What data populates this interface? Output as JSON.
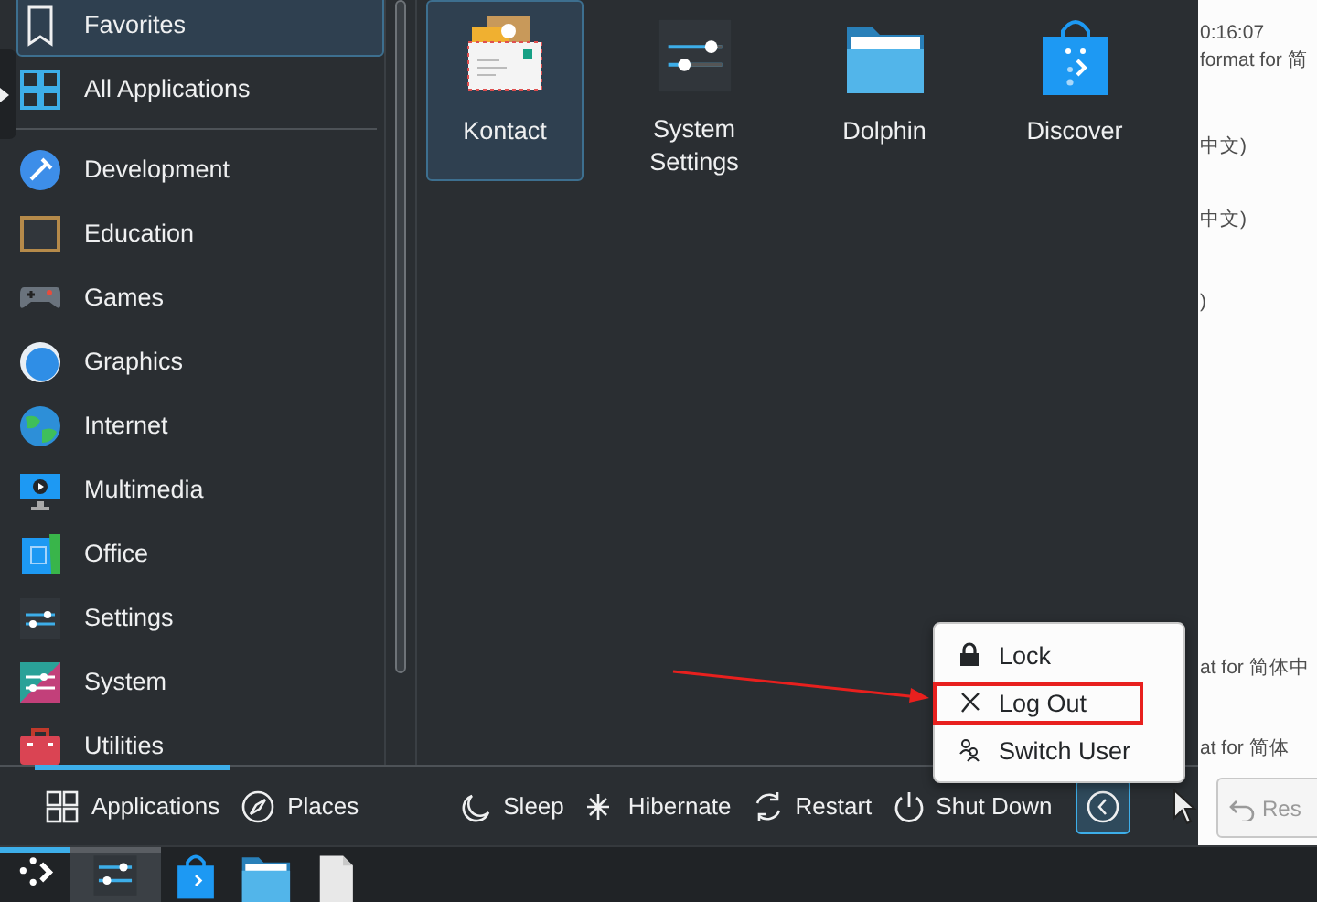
{
  "sidebar": {
    "items": [
      {
        "label": "Favorites",
        "selected": true
      },
      {
        "label": "All Applications",
        "selected": false
      }
    ],
    "categories": [
      {
        "label": "Development"
      },
      {
        "label": "Education"
      },
      {
        "label": "Games"
      },
      {
        "label": "Graphics"
      },
      {
        "label": "Internet"
      },
      {
        "label": "Multimedia"
      },
      {
        "label": "Office"
      },
      {
        "label": "Settings"
      },
      {
        "label": "System"
      },
      {
        "label": "Utilities"
      }
    ]
  },
  "favorites": [
    {
      "label": "Kontact",
      "selected": true
    },
    {
      "label": "System Settings",
      "selected": false
    },
    {
      "label": "Dolphin",
      "selected": false
    },
    {
      "label": "Discover",
      "selected": false
    }
  ],
  "tabs": [
    {
      "label": "Applications",
      "selected": true
    },
    {
      "label": "Places",
      "selected": false
    }
  ],
  "power_actions": [
    {
      "label": "Sleep"
    },
    {
      "label": "Hibernate"
    },
    {
      "label": "Restart"
    },
    {
      "label": "Shut Down"
    }
  ],
  "session_menu": {
    "expanded": true,
    "items": [
      {
        "label": "Lock",
        "highlighted": false
      },
      {
        "label": "Log Out",
        "highlighted": true
      },
      {
        "label": "Switch User",
        "highlighted": false
      }
    ]
  },
  "background_window": {
    "texts": [
      "0:16:07",
      "format for 简",
      "中文)",
      "中文)",
      ")",
      "at for 简体中",
      "at for 简体"
    ],
    "button": "Res"
  },
  "taskbar": [
    {
      "kind": "launcher",
      "active": true
    },
    {
      "kind": "settings",
      "active": true
    },
    {
      "kind": "store",
      "active": false
    },
    {
      "kind": "folder",
      "active": false
    },
    {
      "kind": "file",
      "active": false
    }
  ]
}
